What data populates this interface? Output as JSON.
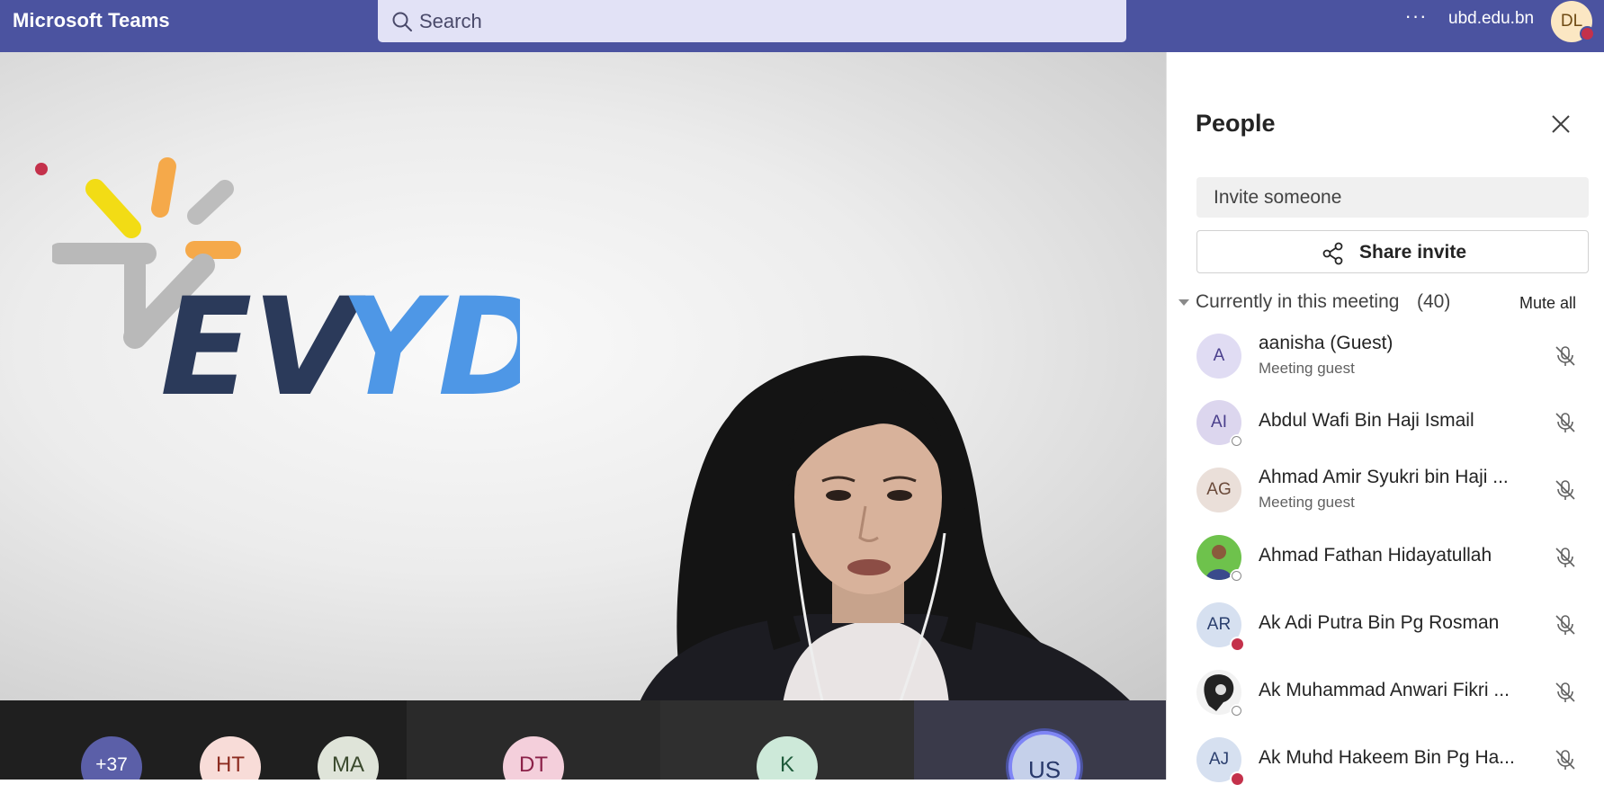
{
  "app": {
    "title": "Microsoft Teams",
    "org": "ubd.edu.bn",
    "user_initials": "DL",
    "more_label": "···"
  },
  "search": {
    "placeholder": "Search"
  },
  "stage": {
    "logo_text_ev": "EV",
    "logo_text_yd": "YD"
  },
  "strip": {
    "overflow": "+37",
    "tiles": [
      "HT",
      "MA",
      "DT",
      "K",
      "US"
    ]
  },
  "panel": {
    "title": "People",
    "invite_placeholder": "Invite someone",
    "share_label": "Share invite",
    "section_label": "Currently in this meeting",
    "section_count": "(40)",
    "mute_all": "Mute all",
    "people": [
      {
        "initials": "A",
        "name": "aanisha (Guest)",
        "sub": "Meeting guest"
      },
      {
        "initials": "AI",
        "name": "Abdul Wafi Bin Haji Ismail",
        "sub": ""
      },
      {
        "initials": "AG",
        "name": "Ahmad Amir Syukri bin Haji ...",
        "sub": "Meeting guest"
      },
      {
        "initials": "",
        "name": "Ahmad Fathan Hidayatullah",
        "sub": ""
      },
      {
        "initials": "AR",
        "name": "Ak Adi Putra Bin Pg Rosman",
        "sub": ""
      },
      {
        "initials": "",
        "name": "Ak Muhammad Anwari Fikri ...",
        "sub": ""
      },
      {
        "initials": "AJ",
        "name": "Ak Muhd Hakeem Bin Pg Ha...",
        "sub": ""
      }
    ]
  },
  "colors": {
    "brand_bar": "#4b53a0",
    "busy": "#c4314b",
    "logo_dark": "#2b3a5a",
    "logo_blue": "#4e97e6"
  }
}
